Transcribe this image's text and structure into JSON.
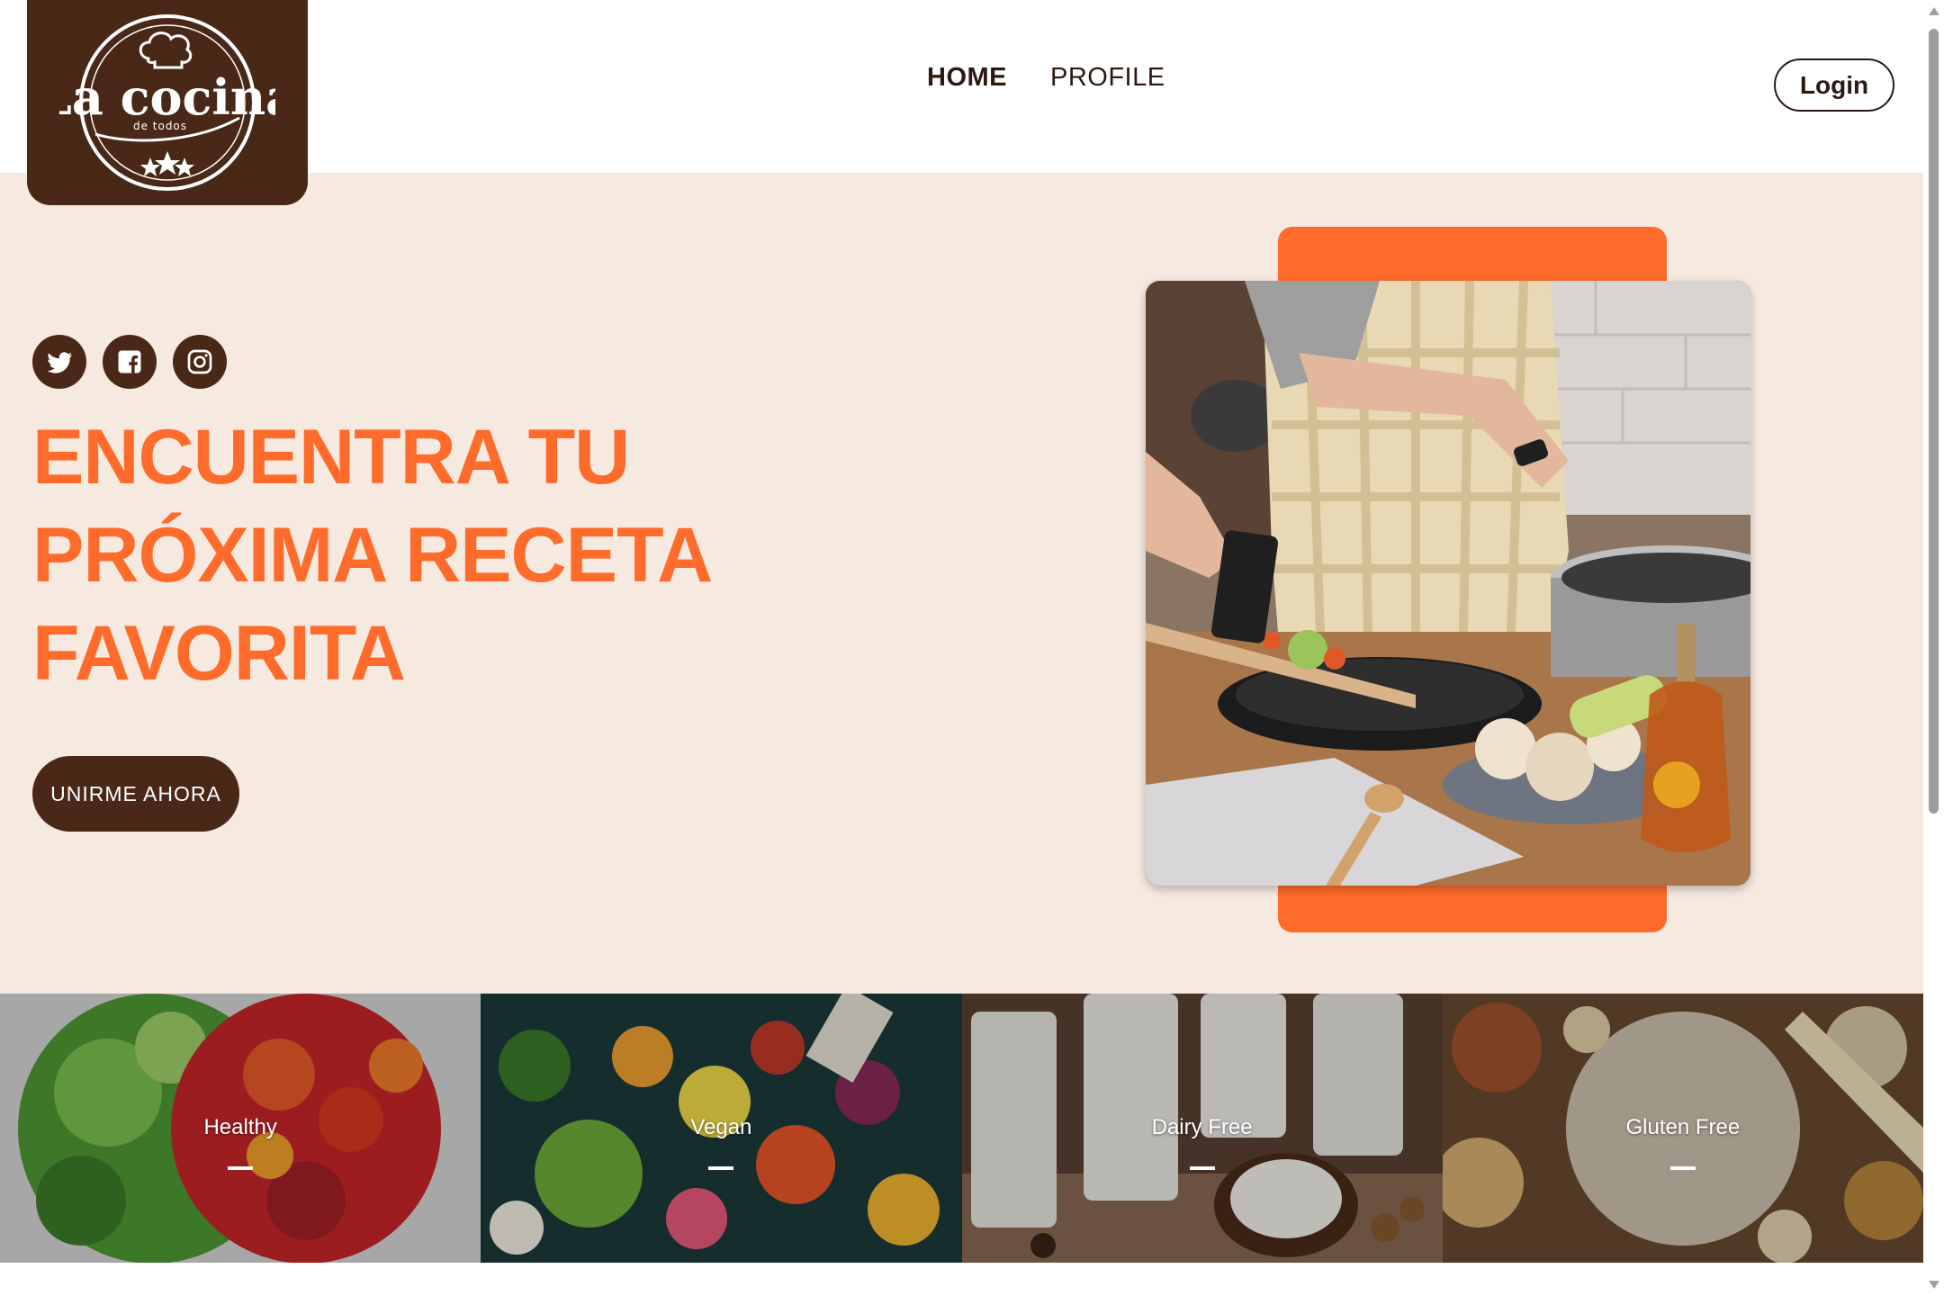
{
  "brand": {
    "logo_title": "La cocina",
    "logo_subtitle": "de todos"
  },
  "nav": {
    "items": [
      {
        "label": "HOME",
        "active": true
      },
      {
        "label": "PROFILE",
        "active": false
      }
    ],
    "login_label": "Login"
  },
  "hero": {
    "social_icons": [
      "twitter-icon",
      "facebook-icon",
      "instagram-icon"
    ],
    "title_lines": [
      "ENCUENTRA TU",
      "PRÓXIMA RECETA",
      "FAVORITA"
    ],
    "cta_label": "UNIRME AHORA"
  },
  "categories": [
    {
      "label": "Healthy"
    },
    {
      "label": "Vegan"
    },
    {
      "label": "Dairy Free"
    },
    {
      "label": "Gluten Free"
    }
  ],
  "colors": {
    "brand_brown": "#4a2818",
    "accent_orange": "#fe6b2a",
    "hero_background": "#f5e9e0",
    "text_dark": "#2b1a12"
  }
}
